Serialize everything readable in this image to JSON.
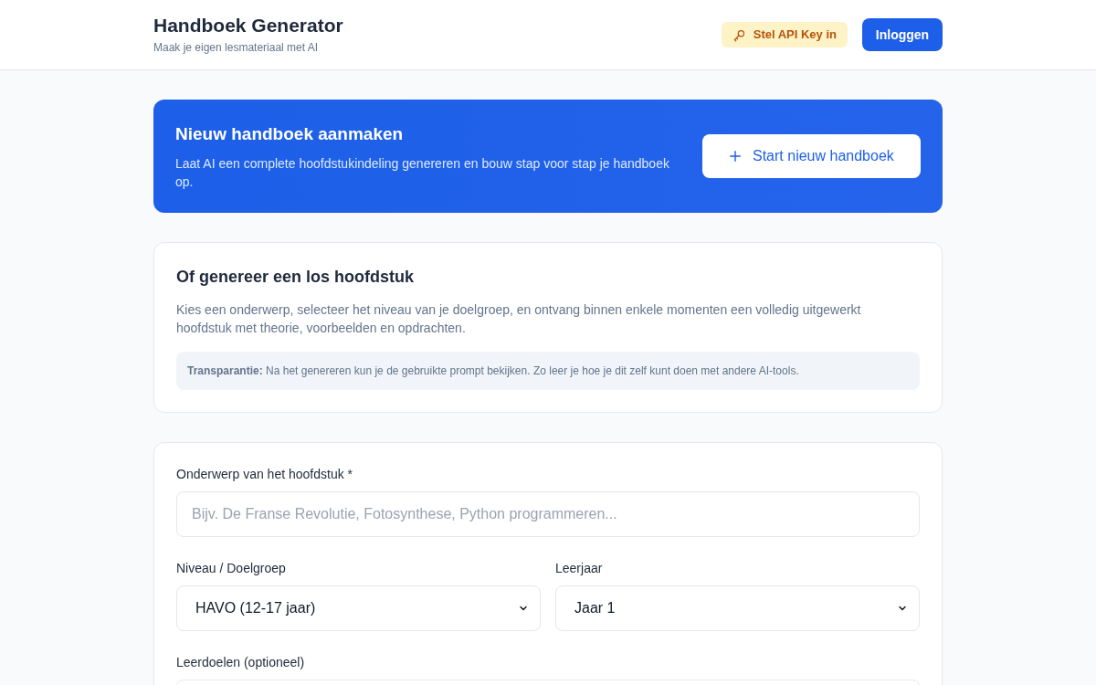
{
  "header": {
    "title": "Handboek Generator",
    "subtitle": "Maak je eigen lesmateriaal met AI",
    "api_key_button": "Stel API Key in",
    "login_button": "Inloggen"
  },
  "hero": {
    "title": "Nieuw handboek aanmaken",
    "description": "Laat AI een complete hoofdstukindeling genereren en bouw stap voor stap je handboek op.",
    "button": "Start nieuw handboek"
  },
  "intro": {
    "title": "Of genereer een los hoofdstuk",
    "description": "Kies een onderwerp, selecteer het niveau van je doelgroep, en ontvang binnen enkele momenten een volledig uitgewerkt hoofdstuk met theorie, voorbeelden en opdrachten.",
    "note": "**Transparantie:** Na het genereren kun je de gebruikte prompt bekijken. Zo leer je hoe je dit zelf kunt doen met andere AI-tools."
  },
  "form": {
    "topic": {
      "label": "Onderwerp van het hoofdstuk *",
      "placeholder": "Bijv. De Franse Revolutie, Fotosynthese, Python programmeren..."
    },
    "level": {
      "label": "Niveau / Doelgroep",
      "value": "HAVO (12-17 jaar)"
    },
    "year": {
      "label": "Leerjaar",
      "value": "Jaar 1"
    },
    "goals": {
      "label": "Leerdoelen (optioneel)"
    }
  }
}
